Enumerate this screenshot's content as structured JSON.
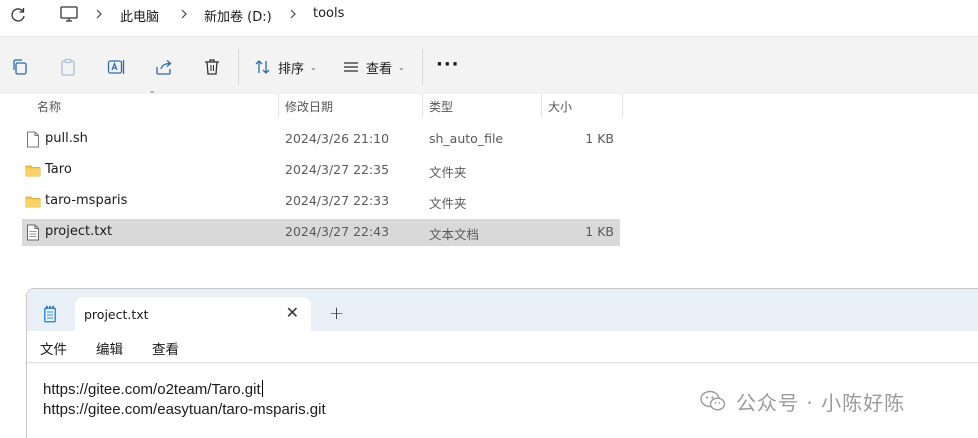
{
  "addressbar": {
    "breadcrumbs": [
      "此电脑",
      "新加卷 (D:)",
      "tools"
    ]
  },
  "toolbar": {
    "sort_label": "排序",
    "view_label": "查看"
  },
  "filelist": {
    "columns": [
      "名称",
      "修改日期",
      "类型",
      "大小"
    ],
    "rows": [
      {
        "name": "pull.sh",
        "date": "2024/3/26 21:10",
        "type": "sh_auto_file",
        "size": "1 KB",
        "icon": "file-icon"
      },
      {
        "name": "Taro",
        "date": "2024/3/27 22:35",
        "type": "文件夹",
        "size": "",
        "icon": "folder-icon"
      },
      {
        "name": "taro-msparis",
        "date": "2024/3/27 22:33",
        "type": "文件夹",
        "size": "",
        "icon": "folder-icon"
      },
      {
        "name": "project.txt",
        "date": "2024/3/27 22:43",
        "type": "文本文档",
        "size": "1 KB",
        "icon": "text-file-icon",
        "selected": true
      }
    ]
  },
  "notepad": {
    "tab_title": "project.txt",
    "menu": [
      "文件",
      "编辑",
      "查看"
    ],
    "lines": [
      "https://gitee.com/o2team/Taro.git",
      "https://gitee.com/easytuan/taro-msparis.git"
    ]
  },
  "watermark": {
    "text": "公众号 · 小陈好陈"
  },
  "colors": {
    "selection": "#d9d9d9",
    "folder": "#f2c54b",
    "notepad_titlebar": "#e9eff7"
  }
}
